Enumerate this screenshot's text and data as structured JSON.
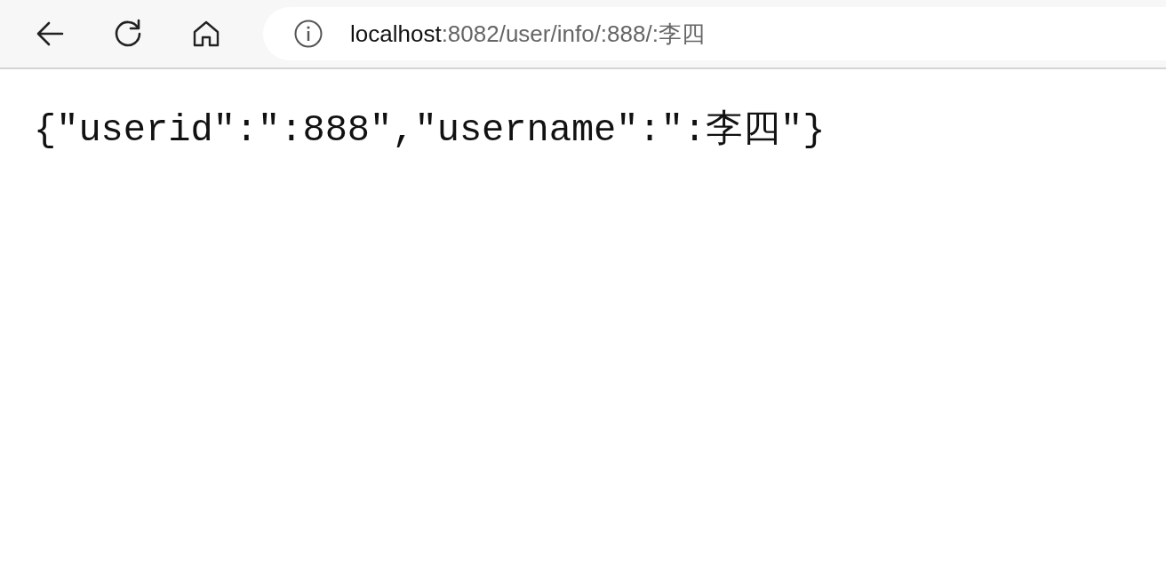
{
  "toolbar": {
    "address_bar": {
      "host": "localhost",
      "path": ":8082/user/info/:888/:李四"
    }
  },
  "page": {
    "body_text": "{\"userid\":\":888\",\"username\":\":李四\"}"
  }
}
